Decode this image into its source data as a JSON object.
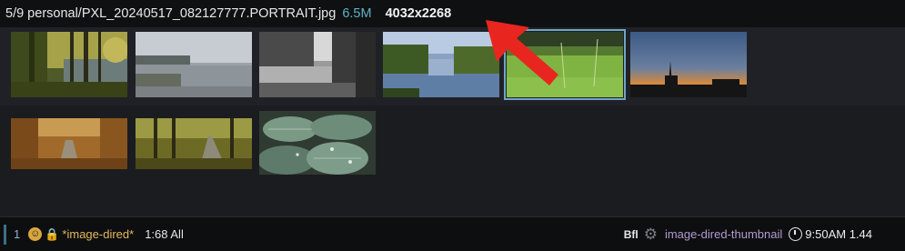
{
  "header": {
    "file_label": "5/9 personal/PXL_20240517_082127777.PORTRAIT.jpg",
    "file_size": "6.5M",
    "dimensions": "4032x2268"
  },
  "thumbnails": [
    {
      "scene": "forest-lake-trees",
      "selected": false
    },
    {
      "scene": "calm-lake-shore",
      "selected": false
    },
    {
      "scene": "black-white-tree-water",
      "selected": false
    },
    {
      "scene": "river-with-trees",
      "selected": false
    },
    {
      "scene": "green-grass-field",
      "selected": true
    },
    {
      "scene": "church-sunset-silhouette",
      "selected": false
    },
    {
      "scene": "autumn-path-trees",
      "selected": false
    },
    {
      "scene": "autumn-road-forest",
      "selected": false
    },
    {
      "scene": "hosta-leaves-dew",
      "selected": false
    }
  ],
  "modeline": {
    "window_number": "1",
    "buffer_name": "*image-dired*",
    "position": "1:68 All",
    "bfl": "Bfl",
    "major_mode": "image-dired-thumbnail",
    "time": "9:50AM 1.44",
    "icons": [
      "emoji-icon",
      "lock-icon",
      "gear-icon",
      "clock-icon"
    ]
  },
  "annotation": {
    "arrow_color": "#e8261f"
  }
}
